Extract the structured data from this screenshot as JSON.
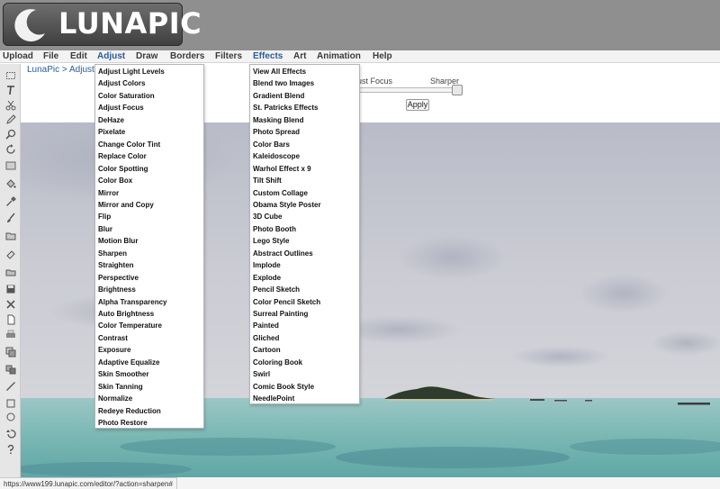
{
  "logo": {
    "text": "LUNAPIC"
  },
  "menubar": {
    "items": [
      "Upload",
      "File",
      "Edit",
      "Adjust",
      "Draw",
      "Borders",
      "Filters",
      "Effects",
      "Art",
      "Animation",
      "Help"
    ],
    "active": [
      "Adjust",
      "Effects"
    ]
  },
  "breadcrumb": {
    "home": "LunaPic",
    "separator": " > ",
    "current": "Adjust"
  },
  "sharpen_panel": {
    "left_label": "ust Focus",
    "right_label": "Sharper",
    "apply_label": "Apply",
    "slider_value": 1.0
  },
  "adjust_menu": {
    "items": [
      "Adjust Light Levels",
      "Adjust Colors",
      "Color Saturation",
      "Adjust Focus",
      "DeHaze",
      "Pixelate",
      "Change Color Tint",
      "Replace Color",
      "Color Spotting",
      "Color Box",
      "Mirror",
      "Mirror and Copy",
      "Flip",
      "Blur",
      "Motion Blur",
      "Sharpen",
      "Straighten",
      "Perspective",
      "Brightness",
      "Alpha Transparency",
      "Auto Brightness",
      "Color Temperature",
      "Contrast",
      "Exposure",
      "Adaptive Equalize",
      "Skin Smoother",
      "Skin Tanning",
      "Normalize",
      "Redeye Reduction",
      "Photo Restore"
    ]
  },
  "effects_menu": {
    "items": [
      "View All Effects",
      "Blend two Images",
      "Gradient Blend",
      "St. Patricks Effects",
      "Masking Blend",
      "Photo Spread",
      "Color Bars",
      "Kaleidoscope",
      "Warhol Effect x 9",
      "Tilt Shift",
      "Custom Collage",
      "Obama Style Poster",
      "3D Cube",
      "Photo Booth",
      "Lego Style",
      "Abstract Outlines",
      "Implode",
      "Explode",
      "Pencil Sketch",
      "Color Pencil Sketch",
      "Surreal Painting",
      "Painted",
      "Gliched",
      "Cartoon",
      "Coloring Book",
      "Swirl",
      "Comic Book Style",
      "NeedlePoint"
    ]
  },
  "toolbar": {
    "tools": [
      "marquee-select-icon",
      "text-tool-icon",
      "scissors-icon",
      "pencil-icon",
      "zoom-icon",
      "rotate-icon",
      "crop-icon",
      "paint-bucket-icon",
      "eyedropper-icon",
      "brush-icon",
      "open-folder-icon",
      "eraser-icon",
      "open-file-icon",
      "save-icon",
      "delete-icon",
      "new-page-icon",
      "print-icon",
      "copy-icon",
      "clone-icon",
      "line-icon",
      "rectangle-icon",
      "circle-icon",
      "undo-icon",
      "help-icon"
    ]
  },
  "status": {
    "url": "https://www199.lunapic.com/editor/?action=sharpen#"
  },
  "colors": {
    "header_bg": "#8f8f8f",
    "menu_active": "#2a5b9a",
    "sky": "#c7c9d2",
    "sea": "#7fb9b5"
  }
}
